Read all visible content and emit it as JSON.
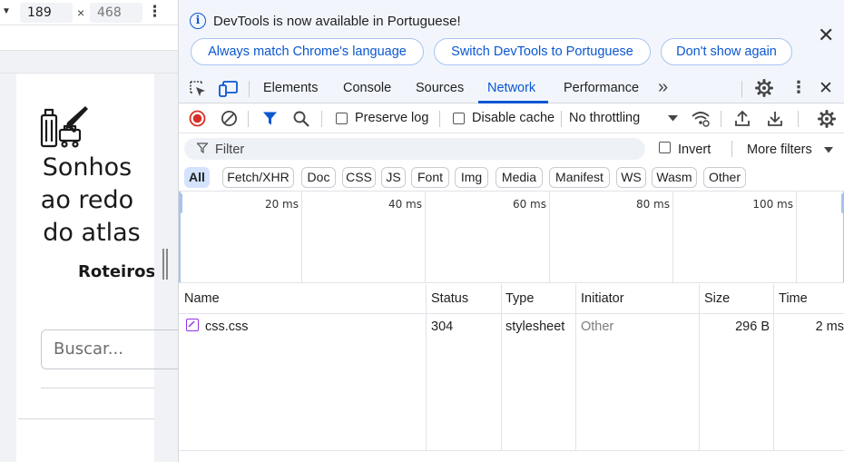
{
  "device_toolbar": {
    "width_value": "189",
    "height_value": "468",
    "times_symbol": "×",
    "dropdown_glyph": "▼",
    "more_glyph": "⋮"
  },
  "page": {
    "title_lines": [
      "Sonhos",
      "ao redo",
      "do atlas"
    ],
    "nav_link": "Roteiros",
    "search_placeholder": "Buscar..."
  },
  "infobar": {
    "message": "DevTools is now available in Portuguese!",
    "buttons": [
      "Always match Chrome's language",
      "Switch DevTools to Portuguese",
      "Don't show again"
    ],
    "close_glyph": "✕"
  },
  "tabs": {
    "items": [
      "Elements",
      "Console",
      "Sources",
      "Network",
      "Performance"
    ],
    "active": "Network",
    "overflow_glyph": "»",
    "more_glyph": "⋮",
    "close_glyph": "✕"
  },
  "toolbar": {
    "preserve_log": "Preserve log",
    "disable_cache": "Disable cache",
    "throttling": "No throttling"
  },
  "filter": {
    "placeholder": "Filter",
    "invert": "Invert",
    "more_filters": "More filters"
  },
  "type_filters": [
    "All",
    "Fetch/XHR",
    "Doc",
    "CSS",
    "JS",
    "Font",
    "Img",
    "Media",
    "Manifest",
    "WS",
    "Wasm",
    "Other"
  ],
  "overview": {
    "ticks": [
      "20 ms",
      "40 ms",
      "60 ms",
      "80 ms",
      "100 ms"
    ]
  },
  "table": {
    "columns": [
      "Name",
      "Status",
      "Type",
      "Initiator",
      "Size",
      "Time"
    ],
    "rows": [
      {
        "name": "css.css",
        "status": "304",
        "type": "stylesheet",
        "initiator": "Other",
        "size": "296 B",
        "time": "2 ms"
      }
    ]
  },
  "colors": {
    "accent": "#0b57d0",
    "record_red": "#d93025",
    "selected_chip": "#d3e3fd",
    "infobar_bg": "#f2f6fc"
  }
}
